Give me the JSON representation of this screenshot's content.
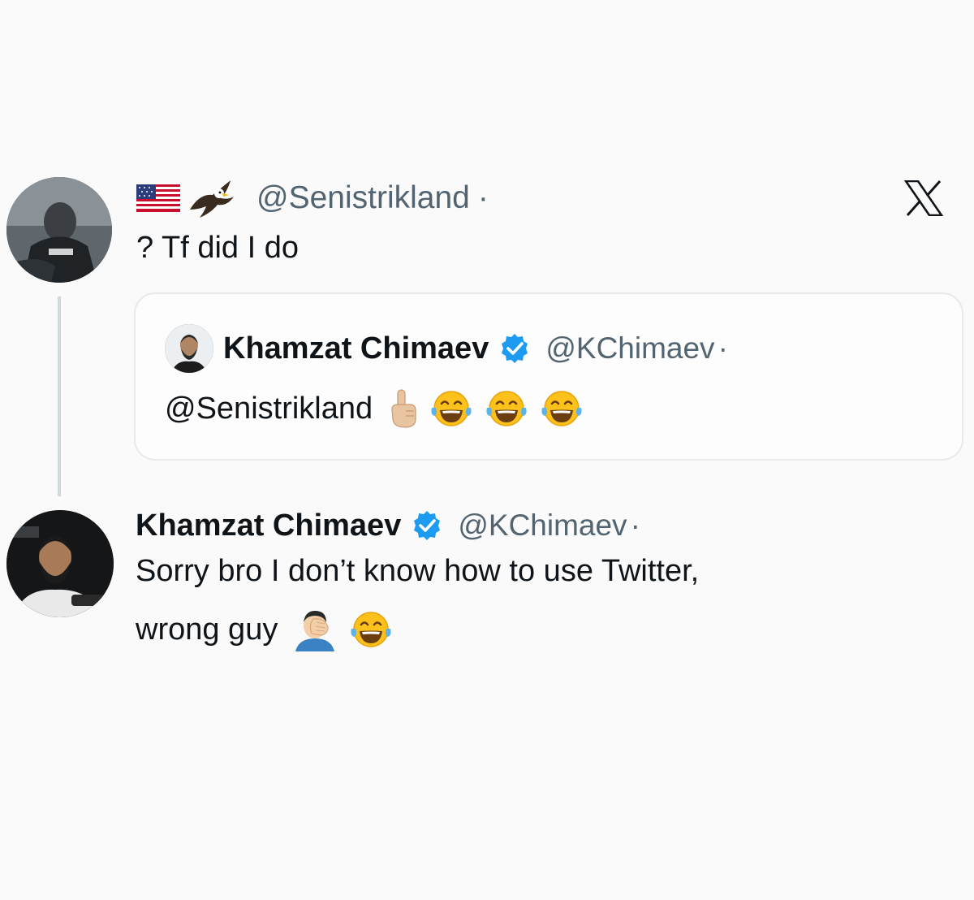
{
  "colors": {
    "text_primary": "#0f1419",
    "text_secondary": "#536471",
    "verified_blue": "#1d9bf0",
    "thread_line": "#cfd9de"
  },
  "brand": {
    "icon": "x-logo-icon"
  },
  "tweet": {
    "flag_icon": "us-flag-icon",
    "eagle_icon": "eagle-icon",
    "handle": "@Senistrikland",
    "separator": "·",
    "text": "? Tf did I do"
  },
  "quote": {
    "name": "Khamzat Chimaev",
    "badge_icon": "verified-badge-icon",
    "handle": "@KChimaev",
    "separator": "·",
    "text": "@Senistrikland",
    "emojis": [
      "index-pointing-up-icon",
      "tears-of-joy-icon",
      "tears-of-joy-icon",
      "tears-of-joy-icon"
    ]
  },
  "reply": {
    "name": "Khamzat Chimaev",
    "badge_icon": "verified-badge-icon",
    "handle": "@KChimaev",
    "separator": "·",
    "line1": "Sorry bro I don’t know how to use Twitter,",
    "line2": "wrong guy",
    "emojis": [
      "man-facepalming-icon",
      "tears-of-joy-icon"
    ]
  }
}
